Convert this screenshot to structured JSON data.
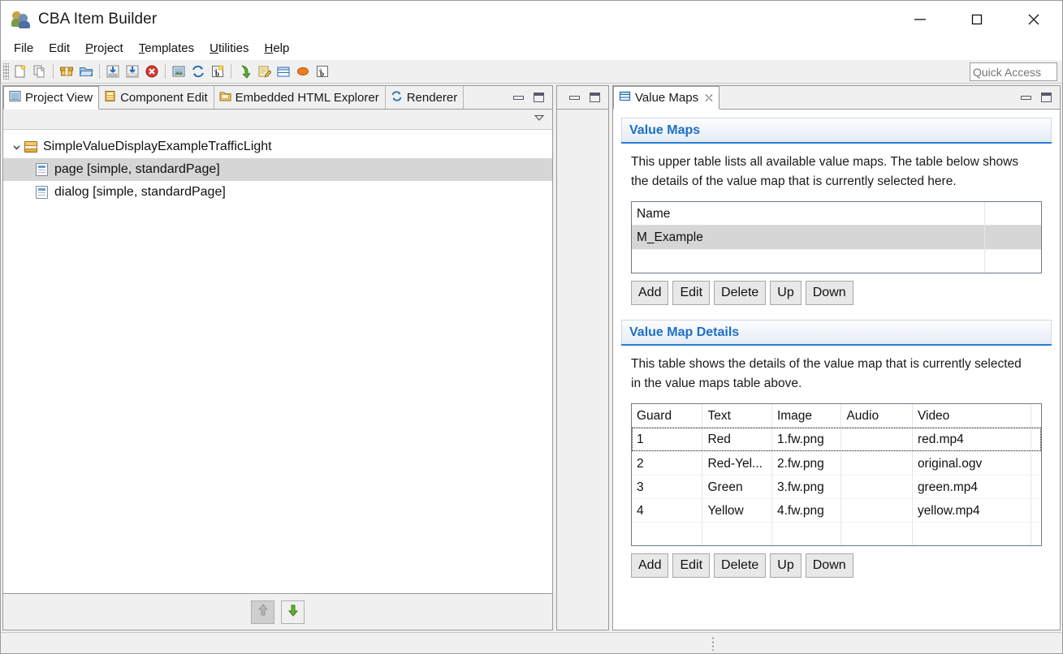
{
  "window": {
    "title": "CBA Item Builder",
    "app_icon": "people-icon",
    "controls": [
      {
        "name": "minimize-button",
        "glyph": "minimize-icon"
      },
      {
        "name": "maximize-button",
        "glyph": "maximize-icon"
      },
      {
        "name": "close-button",
        "glyph": "close-icon"
      }
    ]
  },
  "menubar": {
    "items": [
      {
        "label": "File",
        "mnemonic": "F"
      },
      {
        "label": "Edit",
        "mnemonic": "E"
      },
      {
        "label": "Project",
        "mnemonic": "P"
      },
      {
        "label": "Templates",
        "mnemonic": "T"
      },
      {
        "label": "Utilities",
        "mnemonic": "U"
      },
      {
        "label": "Help",
        "mnemonic": "H"
      }
    ]
  },
  "toolbar": {
    "icons": [
      "new-file-icon",
      "copy-file-icon",
      "open-archive-icon",
      "open-folder-icon",
      "import-icon",
      "import-page-icon",
      "delete-error-icon",
      "image-icon",
      "refresh-icon",
      "text-variable-icon",
      "green-arrow-down-icon",
      "edit-note-icon",
      "table-icon",
      "ellipse-icon",
      "text-variable-b-icon"
    ],
    "quick_access_placeholder": "Quick Access"
  },
  "left_part": {
    "tabs": [
      {
        "label": "Project View",
        "icon": "project-view-icon",
        "active": true
      },
      {
        "label": "Component Edit",
        "icon": "component-edit-icon",
        "active": false
      },
      {
        "label": "Embedded HTML Explorer",
        "icon": "html-explorer-icon",
        "active": false
      },
      {
        "label": "Renderer",
        "icon": "renderer-icon",
        "active": false
      }
    ],
    "filter_menu_glyph": "view-menu-icon",
    "tree": [
      {
        "label": "SimpleValueDisplayExampleTrafficLight",
        "icon": "project-icon",
        "level": 0,
        "expanded": true,
        "selected": false
      },
      {
        "label": "page [simple, standardPage]",
        "icon": "page-icon",
        "level": 1,
        "expanded": false,
        "selected": true
      },
      {
        "label": "dialog [simple, standardPage]",
        "icon": "page-icon",
        "level": 1,
        "expanded": false,
        "selected": false
      }
    ],
    "footer_buttons": [
      {
        "name": "move-up-button",
        "icon": "gray-arrow-up-icon",
        "enabled": false
      },
      {
        "name": "move-down-button",
        "icon": "green-arrow-down-icon",
        "enabled": true
      }
    ]
  },
  "middle_part": {
    "tabs": [],
    "empty": true
  },
  "right_part": {
    "tab": {
      "label": "Value Maps",
      "icon": "value-maps-icon",
      "close_glyph": "close-tab-icon"
    },
    "sections": [
      {
        "title": "Value Maps",
        "description": "This upper table lists all available value maps. The table below shows the details of the value map that is currently selected here.",
        "table": {
          "columns": [
            "Name",
            ""
          ],
          "rows": [
            {
              "cells": [
                "M_Example",
                ""
              ],
              "selected": true
            },
            {
              "cells": [
                "",
                ""
              ],
              "selected": false
            }
          ]
        },
        "buttons": [
          "Add",
          "Edit",
          "Delete",
          "Up",
          "Down"
        ]
      },
      {
        "title": "Value Map Details",
        "description": "This table shows the details of the value map that is currently selected in the value maps table above.",
        "table": {
          "columns": [
            "Guard",
            "Text",
            "Image",
            "Audio",
            "Video"
          ],
          "rows": [
            {
              "cells": [
                "1",
                "Red",
                "1.fw.png",
                "",
                "red.mp4"
              ],
              "focused": true
            },
            {
              "cells": [
                "2",
                "Red-Yel...",
                "2.fw.png",
                "",
                "original.ogv"
              ],
              "focused": false
            },
            {
              "cells": [
                "3",
                "Green",
                "3.fw.png",
                "",
                "green.mp4"
              ],
              "focused": false
            },
            {
              "cells": [
                "4",
                "Yellow",
                "4.fw.png",
                "",
                "yellow.mp4"
              ],
              "focused": false
            },
            {
              "cells": [
                "",
                "",
                "",
                "",
                ""
              ],
              "focused": false
            }
          ]
        },
        "buttons": [
          "Add",
          "Edit",
          "Delete",
          "Up",
          "Down"
        ]
      }
    ]
  },
  "colors": {
    "section_title": "#1e6fc4",
    "section_rule": "#2a7fd4",
    "selection": "#d6d6d6",
    "window_bg": "#f0f0f0"
  }
}
